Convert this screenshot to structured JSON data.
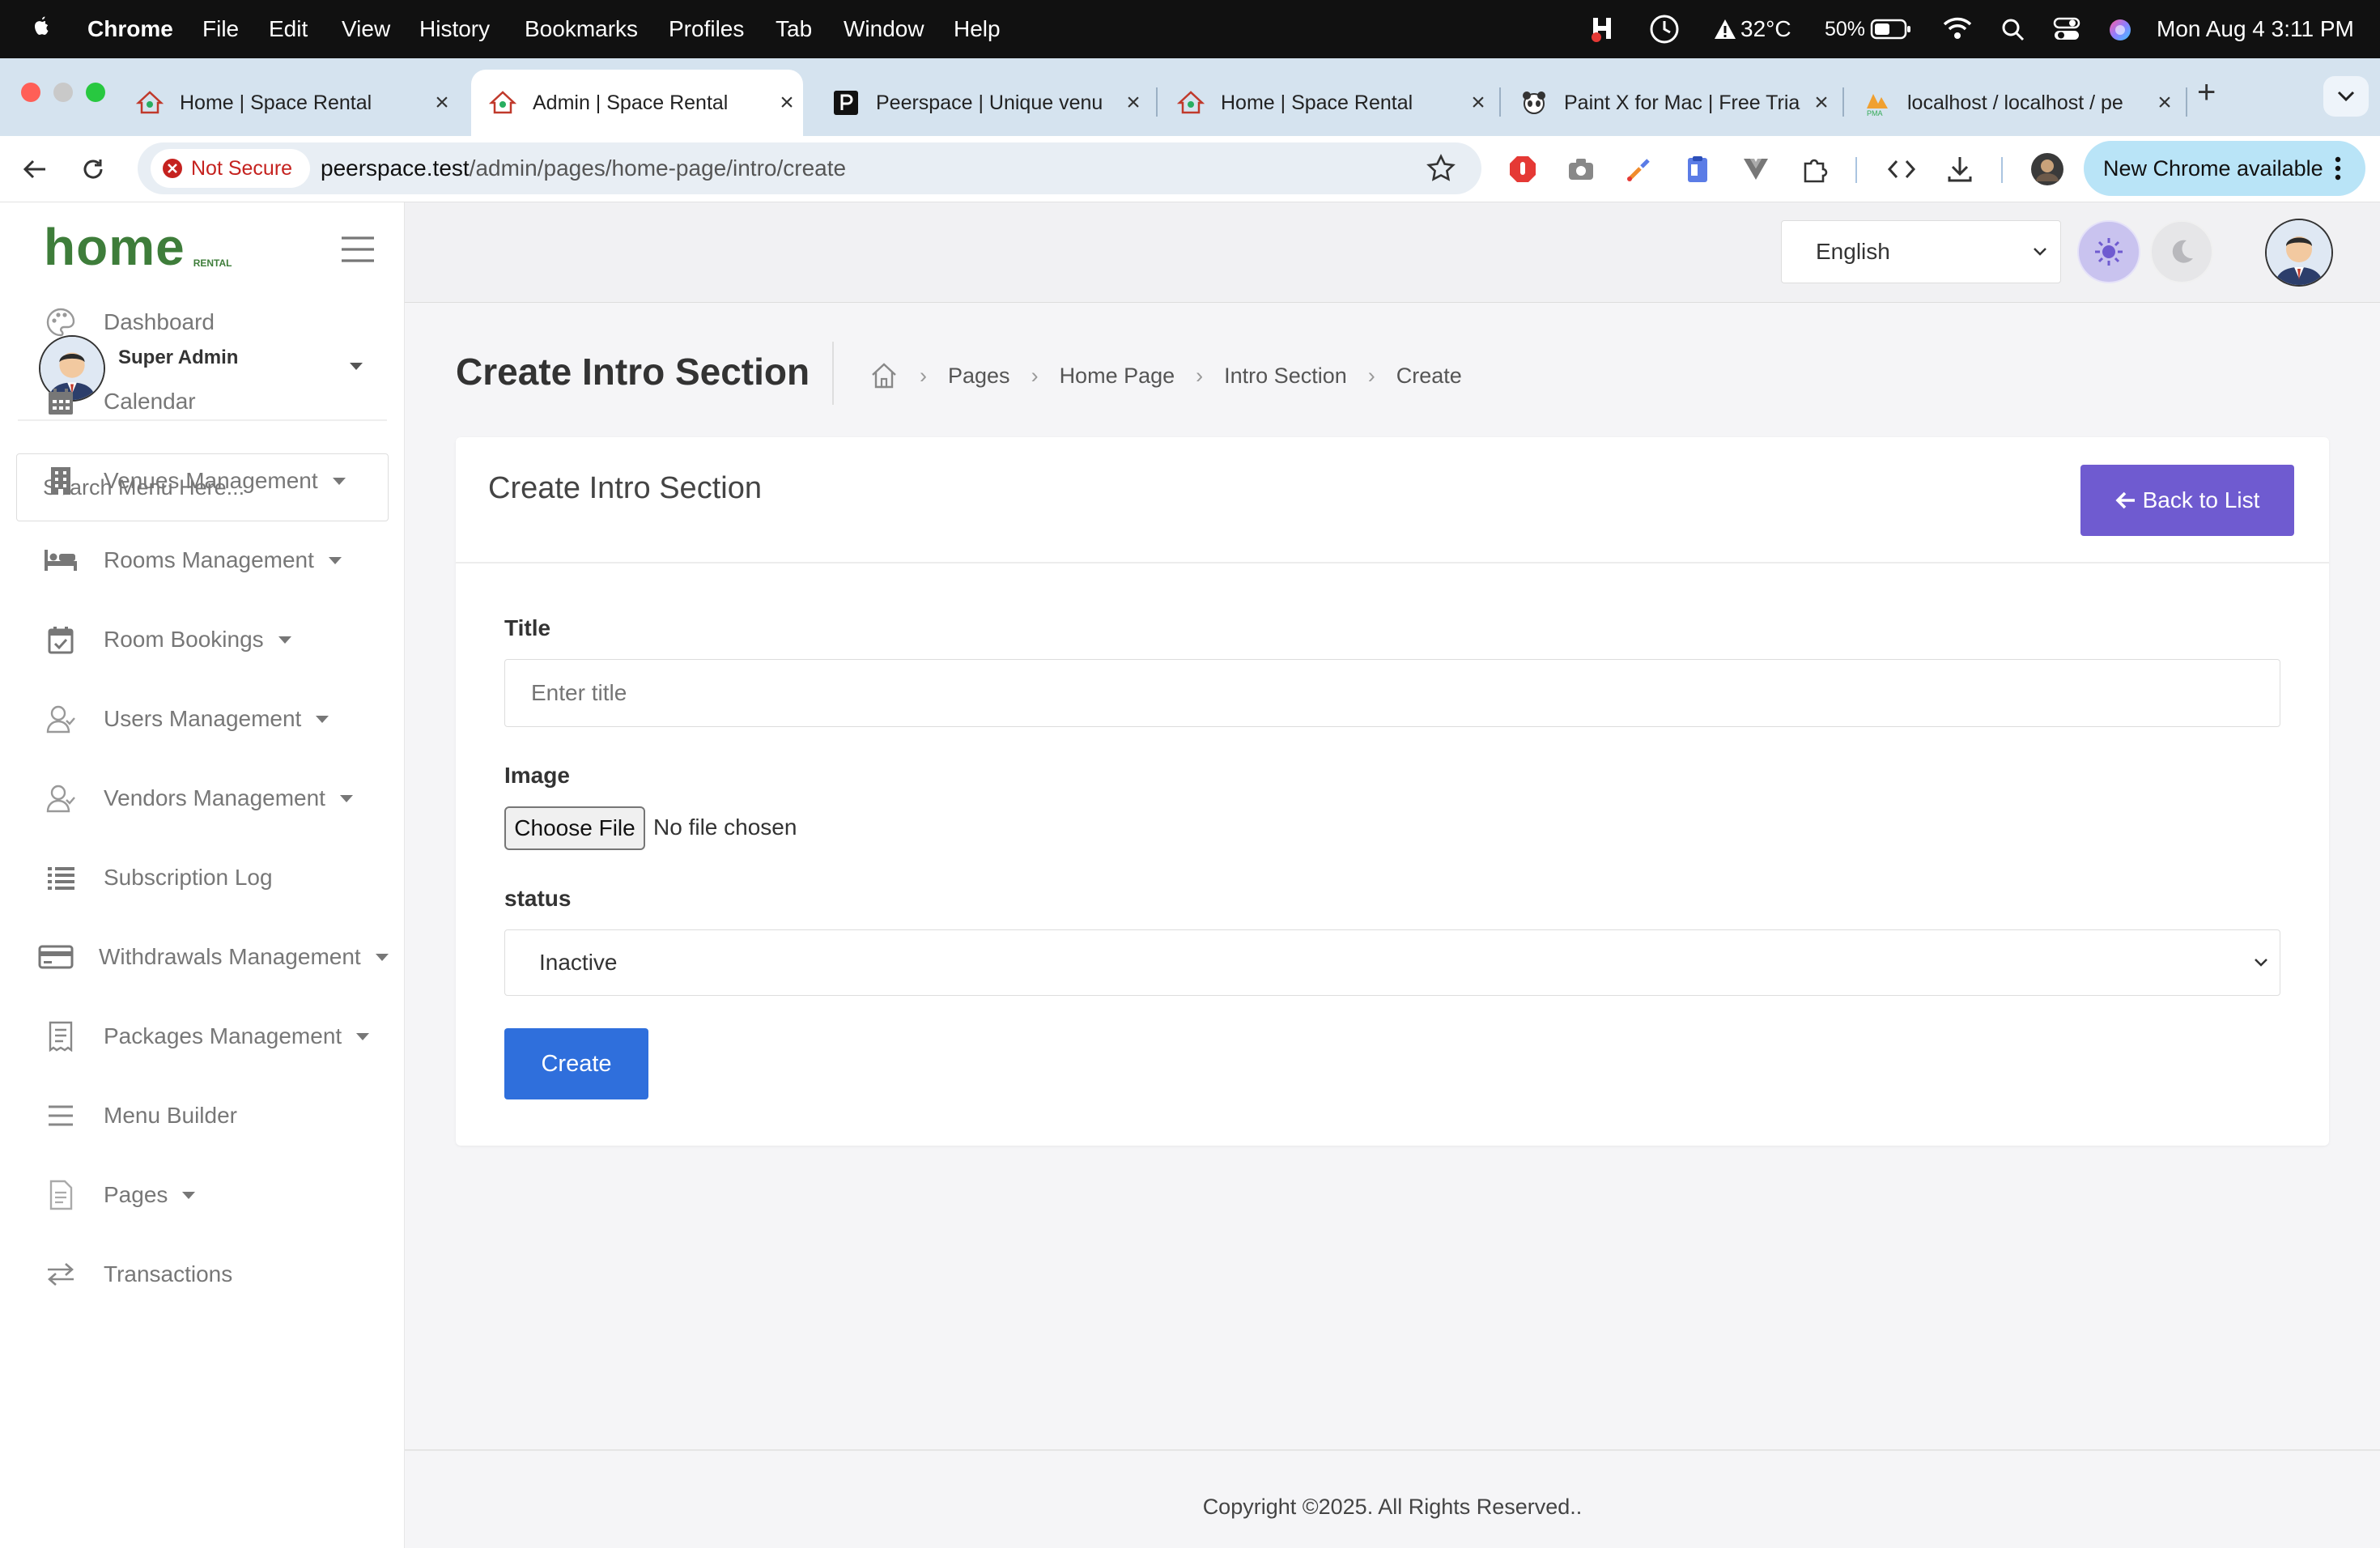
{
  "menubar": {
    "app_name": "Chrome",
    "menus": [
      "File",
      "Edit",
      "View",
      "History",
      "Bookmarks",
      "Profiles",
      "Tab",
      "Window",
      "Help"
    ],
    "weather": "32°C",
    "battery": "50%",
    "datetime": "Mon Aug 4  3:11 PM"
  },
  "tabs": [
    {
      "label": "Home | Space Rental",
      "active": false
    },
    {
      "label": "Admin | Space Rental",
      "active": true
    },
    {
      "label": "Peerspace | Unique venu",
      "active": false
    },
    {
      "label": "Home | Space Rental",
      "active": false
    },
    {
      "label": "Paint X for Mac | Free Tria",
      "active": false
    },
    {
      "label": "localhost / localhost / pe",
      "active": false
    }
  ],
  "toolbar": {
    "security_label": "Not Secure",
    "url_host": "peerspace.test",
    "url_path": "/admin/pages/home-page/intro/create",
    "update_label": "New Chrome available"
  },
  "app": {
    "logo_text": "home",
    "logo_sub": "RENTAL",
    "language": "English",
    "language_options": [
      "English"
    ]
  },
  "sidebar": {
    "user_name": "Super Admin",
    "search_placeholder": "Search Menu Here...",
    "items": [
      {
        "label": "Dashboard",
        "icon": "palette-icon",
        "has_caret": false
      },
      {
        "label": "Calendar",
        "icon": "calendar-icon",
        "has_caret": false
      },
      {
        "label": "Venues Management",
        "icon": "building-icon",
        "has_caret": true
      },
      {
        "label": "Rooms Management",
        "icon": "bed-icon",
        "has_caret": true
      },
      {
        "label": "Room Bookings",
        "icon": "calendar-check-icon",
        "has_caret": true
      },
      {
        "label": "Users Management",
        "icon": "user-icon",
        "has_caret": true
      },
      {
        "label": "Vendors Management",
        "icon": "user-icon",
        "has_caret": true
      },
      {
        "label": "Subscription Log",
        "icon": "list-icon",
        "has_caret": false
      },
      {
        "label": "Withdrawals Management",
        "icon": "credit-card-icon",
        "has_caret": true
      },
      {
        "label": "Packages Management",
        "icon": "receipt-icon",
        "has_caret": true
      },
      {
        "label": "Menu Builder",
        "icon": "menu-lines-icon",
        "has_caret": false
      },
      {
        "label": "Pages",
        "icon": "document-icon",
        "has_caret": true
      },
      {
        "label": "Transactions",
        "icon": "transfer-icon",
        "has_caret": false
      }
    ]
  },
  "page": {
    "title": "Create Intro Section",
    "breadcrumb": [
      "Pages",
      "Home Page",
      "Intro Section",
      "Create"
    ]
  },
  "card": {
    "title": "Create Intro Section",
    "back_button": "Back to List"
  },
  "form": {
    "title_label": "Title",
    "title_placeholder": "Enter title",
    "image_label": "Image",
    "choose_file_label": "Choose File",
    "no_file_text": "No file chosen",
    "status_label": "status",
    "status_value": "Inactive",
    "status_options": [
      "Inactive"
    ],
    "submit_label": "Create"
  },
  "footer": {
    "copyright": "Copyright ©2025. All Rights Reserved.."
  },
  "colors": {
    "accent_purple": "#6f5bd0",
    "primary_blue": "#2f6fdc",
    "logo_green": "#3e7d3a",
    "not_secure_red": "#c5221f"
  }
}
